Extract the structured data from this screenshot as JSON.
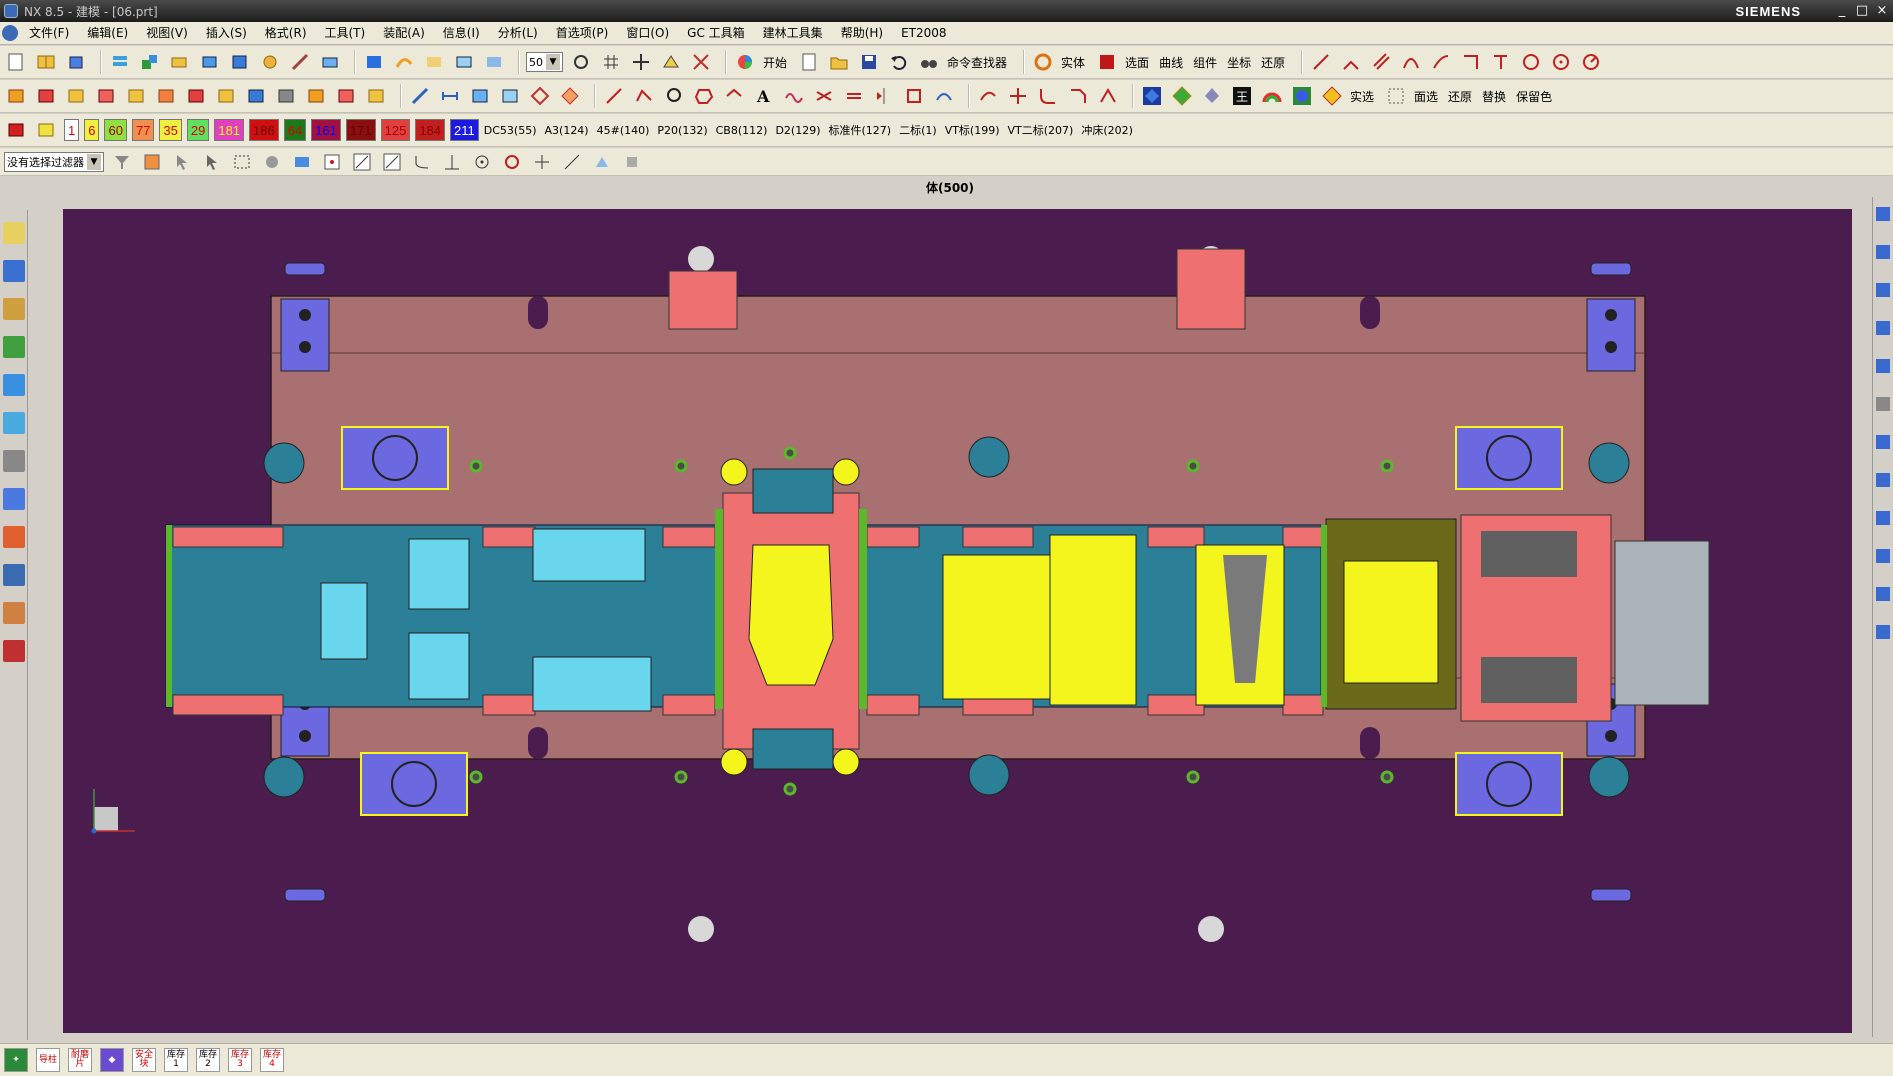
{
  "window": {
    "title": "NX 8.5 - 建模 - [06.prt]",
    "brand": "SIEMENS",
    "controls": [
      "_",
      "□",
      "×"
    ]
  },
  "menu": [
    "文件(F)",
    "编辑(E)",
    "视图(V)",
    "插入(S)",
    "格式(R)",
    "工具(T)",
    "装配(A)",
    "信息(I)",
    "分析(L)",
    "首选项(P)",
    "窗口(O)",
    "GC 工具箱",
    "建林工具集",
    "帮助(H)",
    "ET2008"
  ],
  "toolbar1": {
    "scale_value": "50",
    "start_label": "开始",
    "command_finder": "命令查找器",
    "filters": [
      "实体",
      "选面",
      "曲线",
      "组件",
      "坐标",
      "还原"
    ]
  },
  "toolbar2": {
    "labels": [
      "实选",
      "面选",
      "还原",
      "替换",
      "保留色"
    ]
  },
  "layers": {
    "number_chips": [
      "1",
      "6",
      "60",
      "77",
      "35",
      "29",
      "181",
      "186",
      "64",
      "161",
      "171",
      "125",
      "184",
      "211"
    ],
    "named": [
      "DC53(55)",
      "A3(124)",
      "45#(140)",
      "P20(132)",
      "CB8(112)",
      "D2(129)",
      "标准件(127)",
      "二标(1)",
      "VT标(199)",
      "VT二标(207)",
      "冲床(202)"
    ]
  },
  "selection_bar": {
    "filter_label": "没有选择过滤器"
  },
  "view": {
    "header": "体(500)"
  },
  "status_bar": {
    "buttons": [
      "导柱",
      "耐磨片",
      "安全块",
      "库存1",
      "库存2",
      "库存3",
      "库存4"
    ]
  },
  "colors": {
    "background": "#4b1d4e",
    "plate": "#a87070",
    "blue_steel": "#2b7f96",
    "salmon": "#ee7070",
    "yellow_part": "#f5f51e",
    "purple_guide": "#6c68e0",
    "green_accent": "#5ab82a",
    "grey_feed": "#aab4b8"
  },
  "icons": [
    "new-file-icon",
    "open-icon",
    "save-icon",
    "undo-icon",
    "binoculars-icon",
    "color-wheel-icon",
    "circle-icon",
    "line-icon",
    "text-icon",
    "layer-icon",
    "axis-triad-icon"
  ]
}
